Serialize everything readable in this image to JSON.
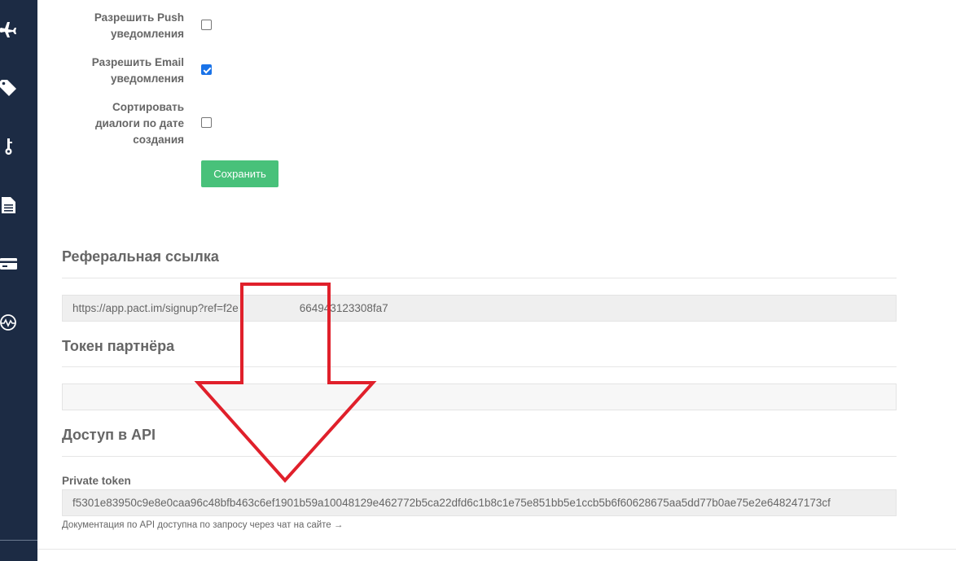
{
  "sidebar": {
    "items": [
      {
        "icon": "airplane-icon"
      },
      {
        "icon": "tag-icon"
      },
      {
        "icon": "key-icon"
      },
      {
        "icon": "document-icon"
      },
      {
        "icon": "credit-card-icon"
      },
      {
        "icon": "pulse-icon"
      }
    ]
  },
  "settings": {
    "push": {
      "label_line1": "Разрешить Push",
      "label_line2": "уведомления",
      "checked": false
    },
    "email": {
      "label_line1": "Разрешить Email",
      "label_line2": "уведомления",
      "checked": true
    },
    "sort": {
      "label_line1": "Сортировать",
      "label_line2": "диалоги по дате",
      "label_line3": "создания",
      "checked": false
    },
    "save_label": "Сохранить"
  },
  "referral": {
    "title": "Реферальная ссылка",
    "link_value": "https://app.pact.im/signup?ref=f2e                    664943123308fa7"
  },
  "partner_token": {
    "title": "Токен партнёра",
    "value": ""
  },
  "api": {
    "title": "Доступ в API",
    "private_token_label": "Private token",
    "private_token_value": "f5301e83950c9e8e0caa96c48bfb463c6ef1901b59a10048129e462772b5ca22dfd6c1b8c1e75e851bb5e1ccb5b6f60628675aa5dd77b0ae75e2e648247173cf",
    "docs_note": "Документация по API доступна по запросу через чат на сайте →"
  },
  "colors": {
    "sidebar_bg": "#1c2b44",
    "save_button": "#48c17a",
    "annotation_arrow": "#e0202b"
  }
}
